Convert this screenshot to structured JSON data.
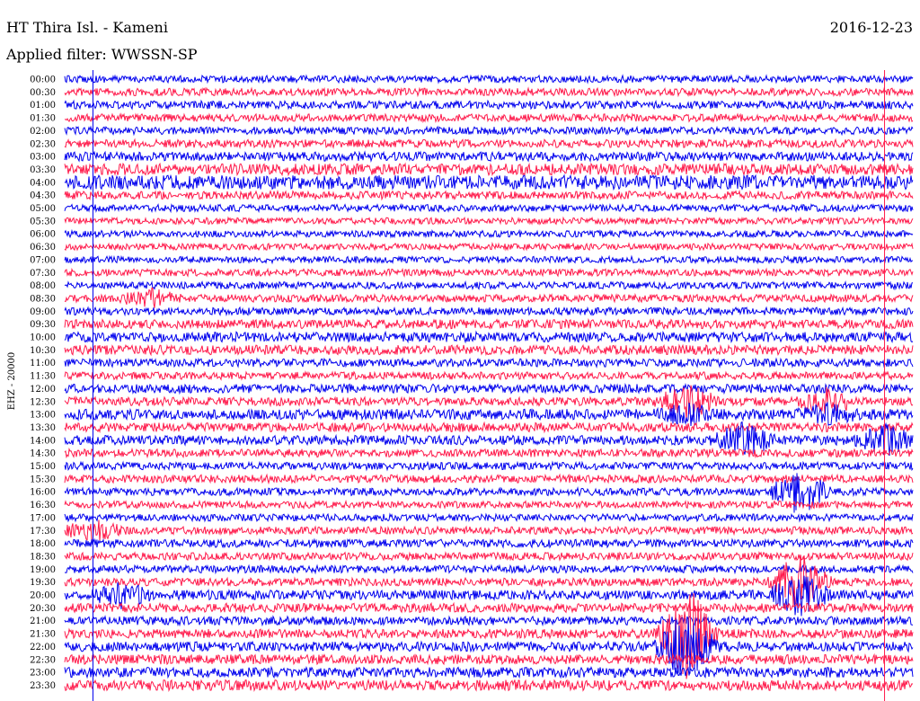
{
  "header": {
    "station": "HT Thira Isl. - Kameni",
    "date": "2016-12-23",
    "filter": "Applied filter: WWSSN-SP"
  },
  "chart_data": {
    "type": "line",
    "title": "HT Thira Isl. - Kameni",
    "subtitle": "Applied filter: WWSSN-SP",
    "date": "2016-12-23",
    "ylabel": "EHZ - 20000",
    "xlabel": "",
    "grid": false,
    "legend": "none",
    "trace_colors": [
      "#0000ee",
      "#ff1a4b"
    ],
    "lines": [
      {
        "time": "00:00",
        "amp": 0.28
      },
      {
        "time": "00:30",
        "amp": 0.3
      },
      {
        "time": "01:00",
        "amp": 0.32
      },
      {
        "time": "01:30",
        "amp": 0.3
      },
      {
        "time": "02:00",
        "amp": 0.3
      },
      {
        "time": "02:30",
        "amp": 0.32
      },
      {
        "time": "03:00",
        "amp": 0.36
      },
      {
        "time": "03:30",
        "amp": 0.45
      },
      {
        "time": "04:00",
        "amp": 0.55
      },
      {
        "time": "04:30",
        "amp": 0.32
      },
      {
        "time": "05:00",
        "amp": 0.28
      },
      {
        "time": "05:30",
        "amp": 0.26
      },
      {
        "time": "06:00",
        "amp": 0.26
      },
      {
        "time": "06:30",
        "amp": 0.26
      },
      {
        "time": "07:00",
        "amp": 0.26
      },
      {
        "time": "07:30",
        "amp": 0.28
      },
      {
        "time": "08:00",
        "amp": 0.28
      },
      {
        "time": "08:30",
        "amp": 0.3
      },
      {
        "time": "09:00",
        "amp": 0.3
      },
      {
        "time": "09:30",
        "amp": 0.36
      },
      {
        "time": "10:00",
        "amp": 0.4
      },
      {
        "time": "10:30",
        "amp": 0.38
      },
      {
        "time": "11:00",
        "amp": 0.32
      },
      {
        "time": "11:30",
        "amp": 0.3
      },
      {
        "time": "12:00",
        "amp": 0.36
      },
      {
        "time": "12:30",
        "amp": 0.34
      },
      {
        "time": "13:00",
        "amp": 0.42
      },
      {
        "time": "13:30",
        "amp": 0.36
      },
      {
        "time": "14:00",
        "amp": 0.38
      },
      {
        "time": "14:30",
        "amp": 0.32
      },
      {
        "time": "15:00",
        "amp": 0.3
      },
      {
        "time": "15:30",
        "amp": 0.32
      },
      {
        "time": "16:00",
        "amp": 0.3
      },
      {
        "time": "16:30",
        "amp": 0.28
      },
      {
        "time": "17:00",
        "amp": 0.28
      },
      {
        "time": "17:30",
        "amp": 0.3
      },
      {
        "time": "18:00",
        "amp": 0.32
      },
      {
        "time": "18:30",
        "amp": 0.3
      },
      {
        "time": "19:00",
        "amp": 0.3
      },
      {
        "time": "19:30",
        "amp": 0.32
      },
      {
        "time": "20:00",
        "amp": 0.38
      },
      {
        "time": "20:30",
        "amp": 0.36
      },
      {
        "time": "21:00",
        "amp": 0.34
      },
      {
        "time": "21:30",
        "amp": 0.36
      },
      {
        "time": "22:00",
        "amp": 0.38
      },
      {
        "time": "22:30",
        "amp": 0.38
      },
      {
        "time": "23:00",
        "amp": 0.4
      },
      {
        "time": "23:30",
        "amp": 0.42
      }
    ],
    "events": [
      {
        "time": "08:30",
        "minute": 3,
        "amp": 0.9
      },
      {
        "time": "12:30",
        "minute": 22,
        "amp": 1.6
      },
      {
        "time": "12:30",
        "minute": 27,
        "amp": 1.2
      },
      {
        "time": "13:00",
        "minute": 22,
        "amp": 1.0
      },
      {
        "time": "13:00",
        "minute": 27,
        "amp": 1.0
      },
      {
        "time": "14:00",
        "minute": 24,
        "amp": 1.6
      },
      {
        "time": "14:00",
        "minute": 29,
        "amp": 1.4
      },
      {
        "time": "16:00",
        "minute": 26,
        "amp": 2.0
      },
      {
        "time": "17:30",
        "minute": 1,
        "amp": 1.0
      },
      {
        "time": "19:30",
        "minute": 26,
        "amp": 2.5
      },
      {
        "time": "20:00",
        "minute": 2,
        "amp": 1.2
      },
      {
        "time": "20:00",
        "minute": 26,
        "amp": 2.0
      },
      {
        "time": "21:30",
        "minute": 22,
        "amp": 4.0
      },
      {
        "time": "22:00",
        "minute": 22,
        "amp": 3.0
      }
    ],
    "marker_lines": [
      {
        "minute": 1,
        "color": "#0000ee"
      },
      {
        "minute": 29,
        "color": "#ff1a4b"
      }
    ]
  }
}
